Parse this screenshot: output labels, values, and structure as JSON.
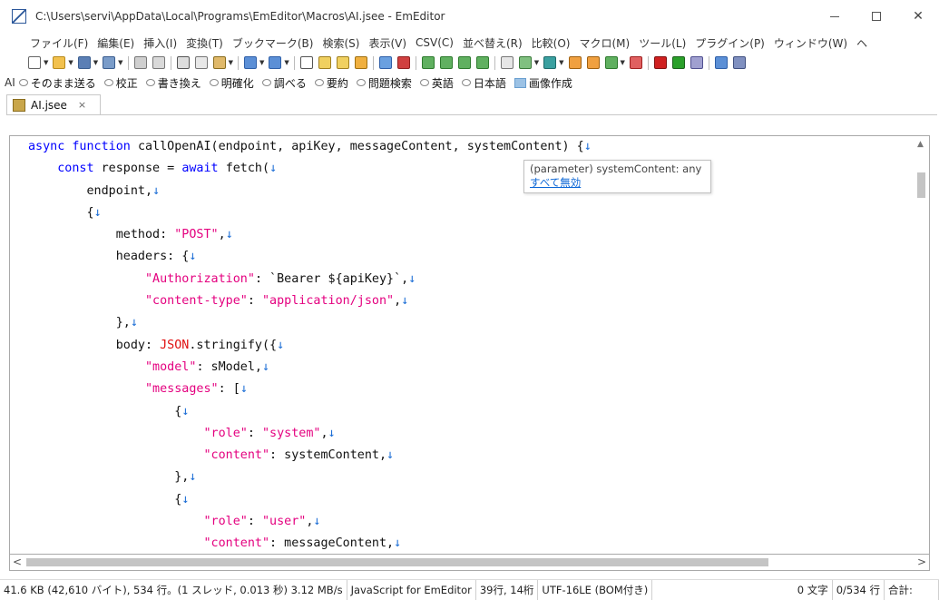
{
  "window": {
    "title": "C:\\Users\\servi\\AppData\\Local\\Programs\\EmEditor\\Macros\\AI.jsee - EmEditor",
    "close_glyph": "✕"
  },
  "menu": [
    "ファイル(F)",
    "編集(E)",
    "挿入(I)",
    "変換(T)",
    "ブックマーク(B)",
    "検索(S)",
    "表示(V)",
    "CSV(C)",
    "並べ替え(R)",
    "比較(O)",
    "マクロ(M)",
    "ツール(L)",
    "プラグイン(P)",
    "ウィンドウ(W)",
    "ヘ"
  ],
  "ai_toolbar": {
    "label": "AI",
    "buttons": [
      "そのまま送る",
      "校正",
      "書き換え",
      "明確化",
      "調べる",
      "要約",
      "問題検索",
      "英語",
      "日本語"
    ],
    "image_button": "画像作成"
  },
  "tab": {
    "label": "AI.jsee",
    "close": "×"
  },
  "code_lines": [
    [
      [
        "kw",
        "async function "
      ],
      [
        "fn",
        "callOpenAI(endpoint, apiKey, messageContent, systemContent) {"
      ],
      [
        "ret",
        "↓"
      ]
    ],
    [
      [
        "fn",
        "    "
      ],
      [
        "kw",
        "const "
      ],
      [
        "fn",
        "response = "
      ],
      [
        "kw",
        "await "
      ],
      [
        "fn",
        "fetch("
      ],
      [
        "ret",
        "↓"
      ]
    ],
    [
      [
        "fn",
        "        endpoint,"
      ],
      [
        "ret",
        "↓"
      ]
    ],
    [
      [
        "fn",
        "        {"
      ],
      [
        "ret",
        "↓"
      ]
    ],
    [
      [
        "fn",
        "            method: "
      ],
      [
        "str",
        "\"POST\""
      ],
      [
        "fn",
        ","
      ],
      [
        "ret",
        "↓"
      ]
    ],
    [
      [
        "fn",
        "            headers: {"
      ],
      [
        "ret",
        "↓"
      ]
    ],
    [
      [
        "fn",
        "                "
      ],
      [
        "str",
        "\"Authorization\""
      ],
      [
        "fn",
        ": `Bearer ${apiKey}`,"
      ],
      [
        "ret",
        "↓"
      ]
    ],
    [
      [
        "fn",
        "                "
      ],
      [
        "str",
        "\"content-type\""
      ],
      [
        "fn",
        ": "
      ],
      [
        "str",
        "\"application/json\""
      ],
      [
        "fn",
        ","
      ],
      [
        "ret",
        "↓"
      ]
    ],
    [
      [
        "fn",
        "            },"
      ],
      [
        "ret",
        "↓"
      ]
    ],
    [
      [
        "fn",
        "            body: "
      ],
      [
        "obj",
        "JSON"
      ],
      [
        "fn",
        ".stringify({"
      ],
      [
        "ret",
        "↓"
      ]
    ],
    [
      [
        "fn",
        "                "
      ],
      [
        "str",
        "\"model\""
      ],
      [
        "fn",
        ": sModel,"
      ],
      [
        "ret",
        "↓"
      ]
    ],
    [
      [
        "fn",
        "                "
      ],
      [
        "str",
        "\"messages\""
      ],
      [
        "fn",
        ": ["
      ],
      [
        "ret",
        "↓"
      ]
    ],
    [
      [
        "fn",
        "                    {"
      ],
      [
        "ret",
        "↓"
      ]
    ],
    [
      [
        "fn",
        "                        "
      ],
      [
        "str",
        "\"role\""
      ],
      [
        "fn",
        ": "
      ],
      [
        "str",
        "\"system\""
      ],
      [
        "fn",
        ","
      ],
      [
        "ret",
        "↓"
      ]
    ],
    [
      [
        "fn",
        "                        "
      ],
      [
        "str",
        "\"content\""
      ],
      [
        "fn",
        ": systemContent,"
      ],
      [
        "ret",
        "↓"
      ]
    ],
    [
      [
        "fn",
        "                    },"
      ],
      [
        "ret",
        "↓"
      ]
    ],
    [
      [
        "fn",
        "                    {"
      ],
      [
        "ret",
        "↓"
      ]
    ],
    [
      [
        "fn",
        "                        "
      ],
      [
        "str",
        "\"role\""
      ],
      [
        "fn",
        ": "
      ],
      [
        "str",
        "\"user\""
      ],
      [
        "fn",
        ","
      ],
      [
        "ret",
        "↓"
      ]
    ],
    [
      [
        "fn",
        "                        "
      ],
      [
        "str",
        "\"content\""
      ],
      [
        "fn",
        ": messageContent,"
      ],
      [
        "ret",
        "↓"
      ]
    ]
  ],
  "tooltip": {
    "title": "(parameter) systemContent: any",
    "link": "すべて無効"
  },
  "status": {
    "info": "41.6 KB (42,610 バイト), 534 行。(1 スレッド, 0.013 秒) 3.12 MB/s",
    "language": "JavaScript for EmEditor",
    "position": "39行, 14桁",
    "encoding": "UTF-16LE (BOM付き)",
    "chars": "0 文字",
    "lines": "0/534 行",
    "sum": "合計:"
  },
  "colors": {
    "keyword": "#0000ff",
    "string": "#e4007f",
    "newline_marker": "#1e6fd6",
    "object": "#e01010"
  }
}
